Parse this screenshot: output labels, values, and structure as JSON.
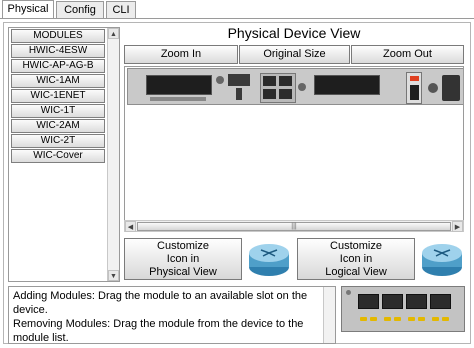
{
  "tabs": [
    {
      "label": "Physical",
      "active": true
    },
    {
      "label": "Config",
      "active": false
    },
    {
      "label": "CLI",
      "active": false
    }
  ],
  "modules": {
    "items": [
      "MODULES",
      "HWIC-4ESW",
      "HWIC-AP-AG-B",
      "WIC-1AM",
      "WIC-1ENET",
      "WIC-1T",
      "WIC-2AM",
      "WIC-2T",
      "WIC-Cover"
    ]
  },
  "view": {
    "title": "Physical Device View",
    "zoom_in": "Zoom In",
    "original_size": "Original Size",
    "zoom_out": "Zoom Out",
    "scroll_grip": "|||"
  },
  "customize": {
    "physical_line1": "Customize",
    "physical_line2": "Icon in",
    "physical_line3": "Physical View",
    "logical_line1": "Customize",
    "logical_line2": "Icon in",
    "logical_line3": "Logical View"
  },
  "description": {
    "line1": "Adding Modules: Drag the module to an available slot on the device.",
    "line2": "Removing Modules: Drag the module from the device to the module list."
  },
  "colors": {
    "router_blue": "#4f9fc9",
    "led_yellow": "#e3b800",
    "power_led": "#e04020"
  },
  "icons": [
    "router-icon",
    "router-icon"
  ]
}
